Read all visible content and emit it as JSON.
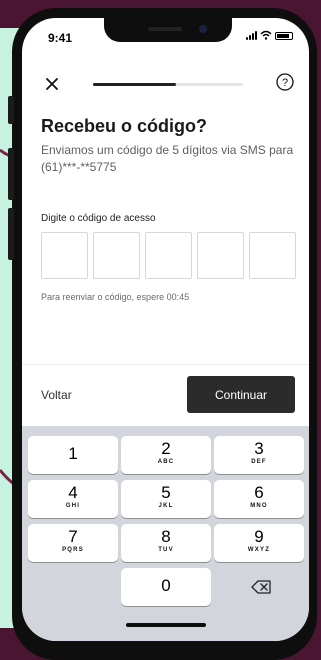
{
  "status_bar": {
    "time": "9:41"
  },
  "header": {
    "progress": 0.55
  },
  "content": {
    "title": "Recebeu o código?",
    "subtitle": "Enviamos um código de 5 dígitos via SMS para (61)***-**5775",
    "code_label": "Digite o código de acesso",
    "code_digits": [
      "",
      "",
      "",
      "",
      ""
    ],
    "resend_text": "Para reenviar o código, espere 00:45"
  },
  "footer": {
    "back_label": "Voltar",
    "continue_label": "Continuar"
  },
  "keypad": {
    "keys": [
      {
        "digit": "1",
        "letters": ""
      },
      {
        "digit": "2",
        "letters": "ABC"
      },
      {
        "digit": "3",
        "letters": "DEF"
      },
      {
        "digit": "4",
        "letters": "GHI"
      },
      {
        "digit": "5",
        "letters": "JKL"
      },
      {
        "digit": "6",
        "letters": "MNO"
      },
      {
        "digit": "7",
        "letters": "PQRS"
      },
      {
        "digit": "8",
        "letters": "TUV"
      },
      {
        "digit": "9",
        "letters": "WXYZ"
      },
      {
        "digit": "0",
        "letters": ""
      }
    ]
  },
  "colors": {
    "background": "#4a1530",
    "accent_mint": "#c6f2df",
    "button_dark": "#2b2b2b",
    "keypad_bg": "#d2d5db"
  }
}
